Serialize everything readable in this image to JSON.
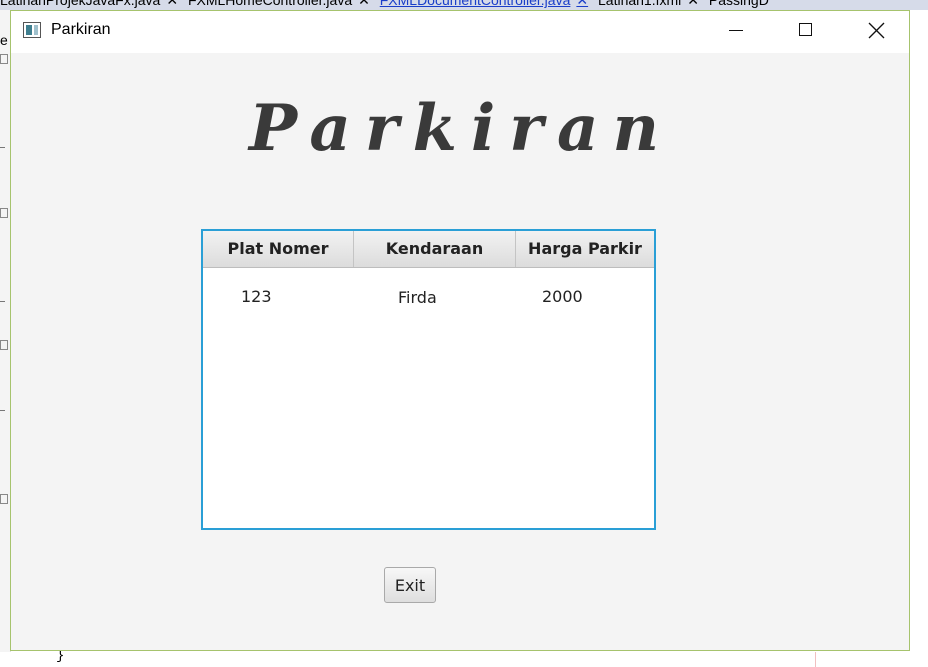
{
  "ide": {
    "tabs": [
      {
        "label": "LatihanProjekJavaFx.java",
        "active": false
      },
      {
        "label": "FXMLHomeController.java",
        "active": false
      },
      {
        "label": "FXMLDocumentController.java",
        "active": true
      },
      {
        "label": "Latihan1.fxml",
        "active": false
      },
      {
        "label": "PassingD",
        "active": false
      }
    ],
    "left_char": "e",
    "brace": "}"
  },
  "window": {
    "title": "Parkiran",
    "icon": "java-app-icon"
  },
  "main": {
    "heading": "Parkiran",
    "table": {
      "columns": [
        "Plat Nomer",
        "Kendaraan",
        "Harga Parkir"
      ],
      "rows": [
        [
          "123",
          "Firda",
          "2000"
        ]
      ]
    },
    "exit_label": "Exit"
  },
  "colors": {
    "table_focus_border": "#2a9fd6",
    "window_border": "#a6c36d",
    "window_bg": "#f4f4f4"
  }
}
